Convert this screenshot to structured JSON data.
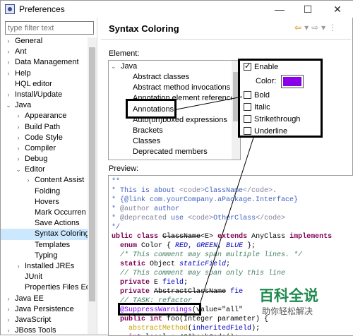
{
  "window": {
    "title": "Preferences",
    "min": "—",
    "max": "☐",
    "close": "✕"
  },
  "filter": {
    "placeholder": "type filter text"
  },
  "tree": [
    {
      "label": "General",
      "level": 0,
      "arrow": "›"
    },
    {
      "label": "Ant",
      "level": 0,
      "arrow": "›"
    },
    {
      "label": "Data Management",
      "level": 0,
      "arrow": "›"
    },
    {
      "label": "Help",
      "level": 0,
      "arrow": "›"
    },
    {
      "label": "HQL editor",
      "level": 0,
      "arrow": ""
    },
    {
      "label": "Install/Update",
      "level": 0,
      "arrow": "›"
    },
    {
      "label": "Java",
      "level": 0,
      "arrow": "⌄"
    },
    {
      "label": "Appearance",
      "level": 1,
      "arrow": "›"
    },
    {
      "label": "Build Path",
      "level": 1,
      "arrow": "›"
    },
    {
      "label": "Code Style",
      "level": 1,
      "arrow": "›"
    },
    {
      "label": "Compiler",
      "level": 1,
      "arrow": "›"
    },
    {
      "label": "Debug",
      "level": 1,
      "arrow": "›"
    },
    {
      "label": "Editor",
      "level": 1,
      "arrow": "⌄"
    },
    {
      "label": "Content Assist",
      "level": 2,
      "arrow": "›"
    },
    {
      "label": "Folding",
      "level": 2,
      "arrow": ""
    },
    {
      "label": "Hovers",
      "level": 2,
      "arrow": ""
    },
    {
      "label": "Mark Occurren",
      "level": 2,
      "arrow": ""
    },
    {
      "label": "Save Actions",
      "level": 2,
      "arrow": ""
    },
    {
      "label": "Syntax Coloring",
      "level": 2,
      "arrow": "",
      "selected": true
    },
    {
      "label": "Templates",
      "level": 2,
      "arrow": ""
    },
    {
      "label": "Typing",
      "level": 2,
      "arrow": ""
    },
    {
      "label": "Installed JREs",
      "level": 1,
      "arrow": "›"
    },
    {
      "label": "JUnit",
      "level": 1,
      "arrow": ""
    },
    {
      "label": "Properties Files Ed",
      "level": 1,
      "arrow": ""
    },
    {
      "label": "Java EE",
      "level": 0,
      "arrow": "›"
    },
    {
      "label": "Java Persistence",
      "level": 0,
      "arrow": "›"
    },
    {
      "label": "JavaScript",
      "level": 0,
      "arrow": "›"
    },
    {
      "label": "JBoss Tools",
      "level": 0,
      "arrow": "›"
    }
  ],
  "page": {
    "title": "Syntax Coloring",
    "nav": {
      "back": "⇦",
      "back_menu": "▾",
      "forward": "⇨",
      "forward_menu": "▾",
      "menu": "⋮"
    },
    "element_label": "Element:",
    "element_list": {
      "group": "Java",
      "group_arrow": "⌄",
      "items": [
        "Abstract classes",
        "Abstract method invocations",
        "Annotation element references",
        "Annotations",
        "Auto(un)boxed expressions",
        "Brackets",
        "Classes",
        "Deprecated members"
      ]
    },
    "options": {
      "enable": "Enable",
      "color": "Color:",
      "color_value": "#8a00e8",
      "bold": "Bold",
      "italic": "Italic",
      "strikethrough": "Strikethrough",
      "underline": "Underline"
    },
    "preview_label": "Preview:"
  },
  "watermark": {
    "big": "百科全说",
    "small": "助你轻松解决"
  }
}
